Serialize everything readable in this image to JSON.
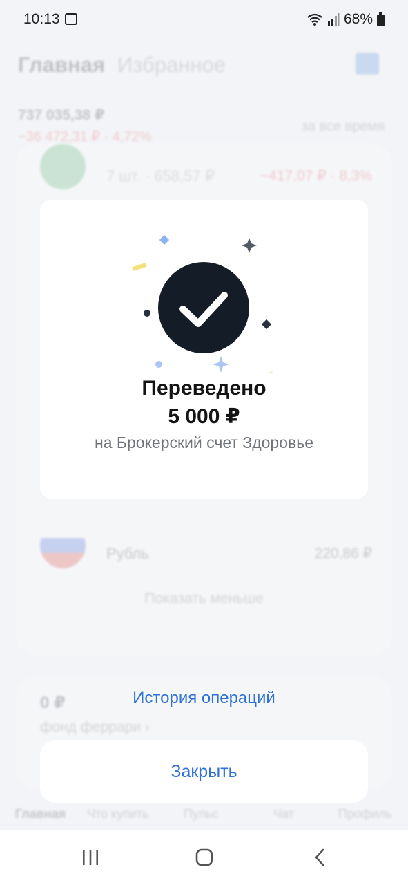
{
  "status_bar": {
    "time": "10:13",
    "battery": "68%"
  },
  "background": {
    "tabs": [
      "Главная",
      "Избранное"
    ],
    "balance": "737 035,38 ₽",
    "change": "−36 472,31 ₽ · 4,72%",
    "period": "за все время",
    "row_partial": {
      "qty": "7 шт. · 658,57 ₽",
      "change": "−417,07 ₽ · 8,3%"
    },
    "currency_row": {
      "name": "Рубль",
      "value": "220,86 ₽"
    },
    "show_less": "Показать меньше",
    "fund": {
      "value": "0 ₽",
      "name": "фонд феррари ›"
    },
    "nav": [
      "Главная",
      "Что купить",
      "Пульс",
      "Чат",
      "Профиль"
    ]
  },
  "dialog": {
    "title": "Переведено",
    "amount": "5 000 ₽",
    "account": "на Брокерский счет Здоровье",
    "icon": "checkmark-icon"
  },
  "actions": {
    "history": "История операций",
    "close": "Закрыть"
  },
  "colors": {
    "accent": "#2f71d6",
    "check_circle": "#141c28"
  }
}
